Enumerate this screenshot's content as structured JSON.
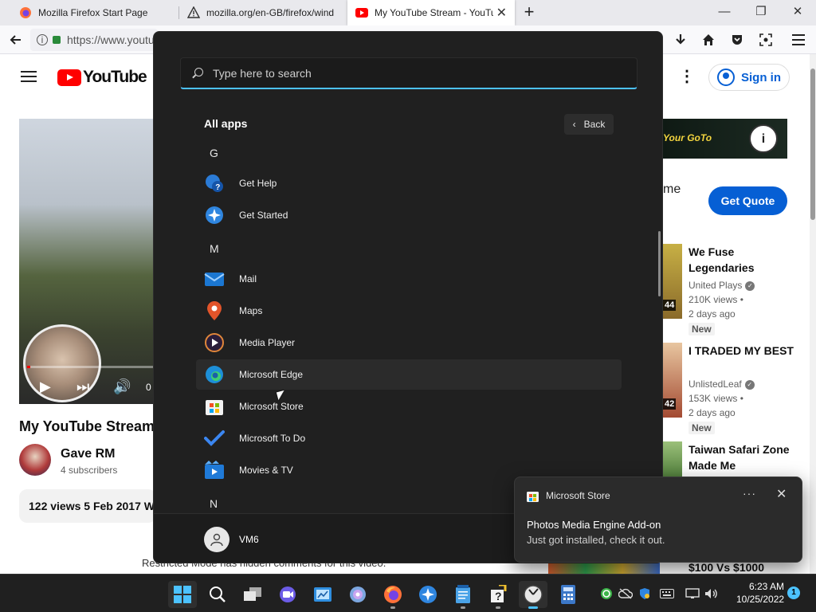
{
  "browser": {
    "tabs": [
      {
        "title": "Mozilla Firefox Start Page"
      },
      {
        "title": "mozilla.org/en-GB/firefox/wind"
      },
      {
        "title": "My YouTube Stream - YouTu"
      }
    ],
    "url": "https://www.youtu"
  },
  "youtube": {
    "logo_text": "YouTube",
    "sign_in": "Sign in",
    "video_time": "0",
    "video_title": "My YouTube Stream",
    "channel_name": "Gave RM",
    "subscribers": "4 subscribers",
    "description": "122 views  5 Feb 2017  W",
    "comments_note": "Restricted Mode has hidden comments for this video.",
    "ad": {
      "banner_text": "Your GoTo",
      "info_icon": "info-icon",
      "tail_text": "me",
      "cta": "Get Quote"
    },
    "recommendations": [
      {
        "title": "We Fuse Legendaries",
        "channel": "United Plays",
        "views": "210K views •",
        "ago": "2 days ago",
        "badge": "New",
        "duration": "44"
      },
      {
        "title": "I TRADED MY BEST",
        "channel": "UnlistedLeaf",
        "views": "153K views •",
        "ago": "2 days ago",
        "badge": "New",
        "duration": "42"
      },
      {
        "title": "Taiwan Safari Zone Made Me",
        "channel": "",
        "views": "",
        "ago": "",
        "badge": "",
        "duration": ""
      }
    ],
    "peek_text": "$100 Vs $1000"
  },
  "start_menu": {
    "search_placeholder": "Type here to search",
    "heading": "All apps",
    "back_label": "Back",
    "sections": [
      {
        "letter": "G",
        "apps": [
          {
            "name": "Get Help",
            "icon": "get-help-icon"
          },
          {
            "name": "Get Started",
            "icon": "get-started-icon"
          }
        ]
      },
      {
        "letter": "M",
        "apps": [
          {
            "name": "Mail",
            "icon": "mail-icon"
          },
          {
            "name": "Maps",
            "icon": "maps-icon"
          },
          {
            "name": "Media Player",
            "icon": "media-player-icon"
          },
          {
            "name": "Microsoft Edge",
            "icon": "edge-icon"
          },
          {
            "name": "Microsoft Store",
            "icon": "store-icon"
          },
          {
            "name": "Microsoft To Do",
            "icon": "todo-icon"
          },
          {
            "name": "Movies & TV",
            "icon": "movies-tv-icon"
          }
        ]
      },
      {
        "letter": "N",
        "apps": []
      }
    ],
    "user_name": "VM6"
  },
  "notification": {
    "app_name": "Microsoft Store",
    "more": "···",
    "title": "Photos Media Engine Add-on",
    "body": "Just got installed, check it out."
  },
  "taskbar": {
    "clock_time": "6:23 AM",
    "clock_date": "10/25/2022",
    "notification_count": "1"
  },
  "colors": {
    "accent": "#4cc2ff",
    "youtube_red": "#ff0000",
    "youtube_blue": "#065fd4",
    "start_bg": "#202020"
  }
}
